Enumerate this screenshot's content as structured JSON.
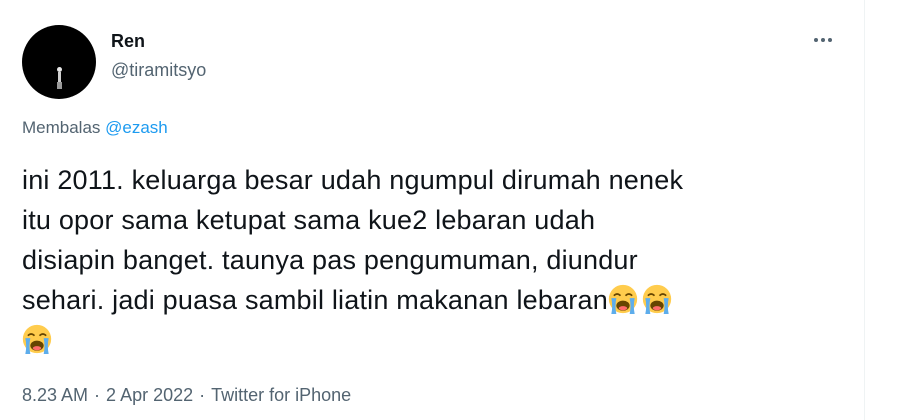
{
  "author": {
    "display_name": "Ren",
    "username": "@tiramitsyo",
    "avatar": "dark-avatar-with-figure"
  },
  "actions": {
    "more_icon": "more-horizontal-icon"
  },
  "reply": {
    "prefix": "Membalas ",
    "mention": "@ezash"
  },
  "tweet": {
    "lines": [
      "ini 2011. keluarga besar udah ngumpul dirumah nenek",
      "itu opor sama ketupat sama kue2 lebaran udah",
      "disiapin banget. taunya pas pengumuman, diundur",
      "sehari. jadi puasa sambil liatin makanan lebaran"
    ],
    "emoji": "loudly-crying-face-emoji"
  },
  "meta": {
    "time": "8.23 AM",
    "separator": "·",
    "date": "2 Apr 2022",
    "source": "Twitter for iPhone"
  }
}
